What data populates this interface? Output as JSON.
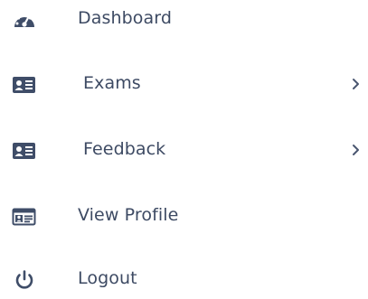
{
  "menu": {
    "items": [
      {
        "label": "Dashboard",
        "icon": "dashboard-gauge-icon",
        "has_submenu": false
      },
      {
        "label": "Exams",
        "icon": "id-card-icon",
        "has_submenu": true
      },
      {
        "label": "Feedback",
        "icon": "id-card-icon",
        "has_submenu": true
      },
      {
        "label": "View Profile",
        "icon": "profile-card-icon",
        "has_submenu": false
      },
      {
        "label": "Logout",
        "icon": "power-icon",
        "has_submenu": false
      }
    ]
  },
  "colors": {
    "icon": "#3f4d68",
    "text": "#3d4a63",
    "chevron": "#4a5670",
    "background": "#ffffff"
  }
}
